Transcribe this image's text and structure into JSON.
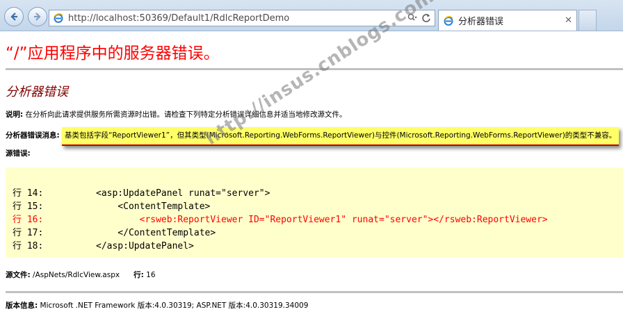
{
  "browser": {
    "url": "http://localhost:50369/Default1/RdlcReportDemo",
    "tab_title": "分析器错误",
    "tab_close": "✕",
    "icons": [
      "back-icon",
      "forward-icon",
      "ie-icon",
      "search-dropdown-icon",
      "refresh-icon",
      "close-icon",
      "new-tab-icon"
    ]
  },
  "page": {
    "title": "“/”应用程序中的服务器错误。",
    "subtitle": "分析器错误",
    "description_label": "说明:",
    "description_text": "在分析向此请求提供服务所需资源时出错。请检查下列特定分析错误详细信息并适当地修改源文件。",
    "parser_label": "分析器错误消息:",
    "parser_message": "基类包括字段“ReportViewer1”，但其类型(Microsoft.Reporting.WebForms.ReportViewer)与控件(Microsoft.Reporting.WebForms.ReportViewer)的类型不兼容。",
    "source_label": "源错误:",
    "code_lines": [
      {
        "no": "行 14:",
        "code": "<asp:UpdatePanel runat=\"server\">"
      },
      {
        "no": "行 15:",
        "code": "    <ContentTemplate>"
      },
      {
        "no": "行 16:",
        "code": "        <rsweb:ReportViewer ID=\"ReportViewer1\" runat=\"server\"></rsweb:ReportViewer>"
      },
      {
        "no": "行 17:",
        "code": "    </ContentTemplate>"
      },
      {
        "no": "行 18:",
        "code": "</asp:UpdatePanel>"
      }
    ],
    "source_file_label": "源文件:",
    "source_file": "/AspNets/RdlcView.aspx",
    "line_label": "行:",
    "line_number": "16",
    "version_label": "版本信息:",
    "version_text": "Microsoft .NET Framework 版本:4.0.30319; ASP.NET 版本:4.0.30319.34009",
    "watermark": "http://insus.cnblogs.com"
  },
  "colors": {
    "title_red": "#ff0000",
    "subtitle_maroon": "#800000",
    "highlight_yellow": "#ffff66",
    "code_background": "#ffffcc"
  }
}
